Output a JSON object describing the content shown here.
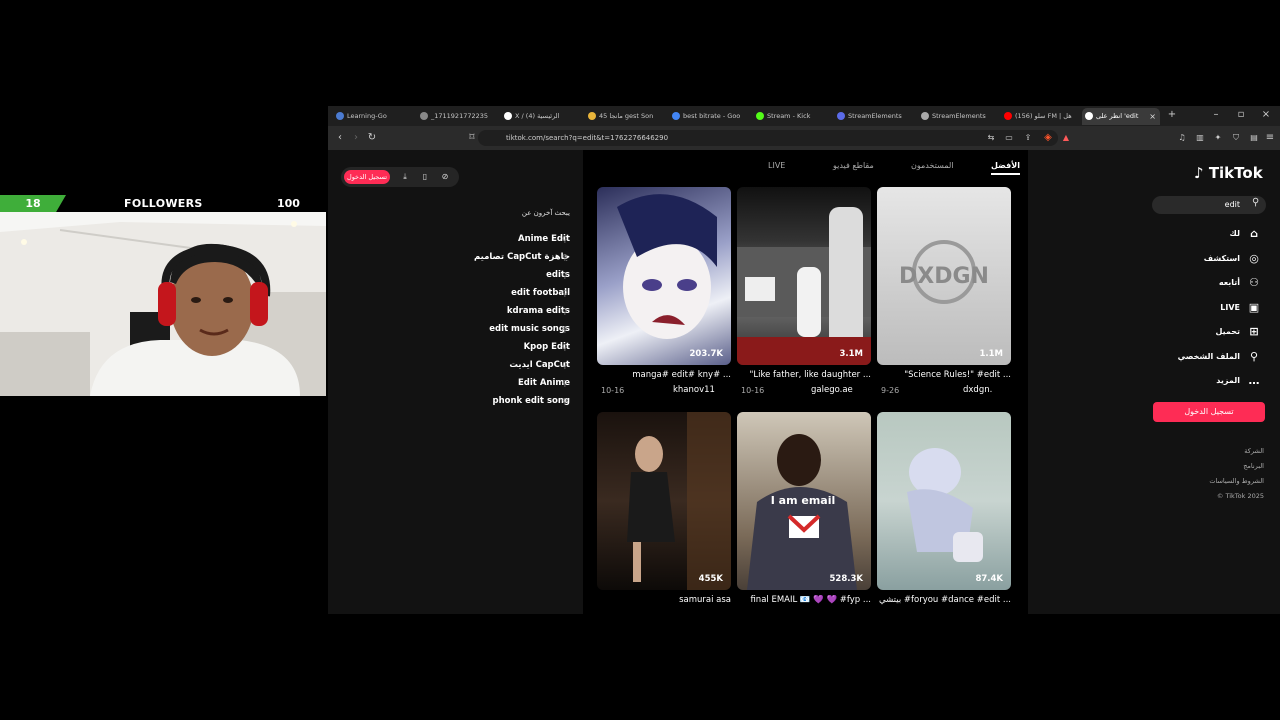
{
  "overlay": {
    "followers_count": "18",
    "followers_label": "FOLLOWERS",
    "followers_goal": "100"
  },
  "browser": {
    "tabs": [
      {
        "label": "Learning-Go"
      },
      {
        "label": "_1711921772235"
      },
      {
        "label": "X / الرئيسية (4)"
      },
      {
        "label": "مانجا 45 gest Son"
      },
      {
        "label": "best bitrate - Goo"
      },
      {
        "label": "Stream - Kick"
      },
      {
        "label": "StreamElements"
      },
      {
        "label": "StreamElements"
      },
      {
        "label": "(156) سلو FM | هل"
      },
      {
        "label": "انظر على 'edit"
      }
    ],
    "url": "tiktok.com/search?q=edit&t=1762276646290"
  },
  "tiktok": {
    "login_small": "تسجيل الدخول",
    "logo": "TikTok",
    "search_value": "edit",
    "nav": [
      {
        "label": "لك",
        "icon": "home-icon",
        "glyph": "⌂"
      },
      {
        "label": "استكشف",
        "icon": "compass-icon",
        "glyph": "◎"
      },
      {
        "label": "أتابعه",
        "icon": "following-icon",
        "glyph": "⚇"
      },
      {
        "label": "LIVE",
        "icon": "live-icon",
        "glyph": "▣"
      },
      {
        "label": "تحميل",
        "icon": "upload-icon",
        "glyph": "⊞"
      },
      {
        "label": "الملف الشخصي",
        "icon": "profile-icon",
        "glyph": "⚲"
      },
      {
        "label": "المزيد",
        "icon": "more-icon",
        "glyph": "…"
      }
    ],
    "login_big": "تسجيل الدخول",
    "footer": [
      "الشركة",
      "البرنامج",
      "الشروط والسياسات",
      "© TikTok 2025"
    ],
    "tabs": [
      "الأفضل",
      "المستخدمون",
      "مقاطع فيديو",
      "LIVE"
    ],
    "people_title": "يبحث آخرون عن",
    "suggestions": [
      "Anime Edit",
      "تصاميم CapCut جاهزة",
      "edits",
      "edit football",
      "kdrama edits",
      "edit music songs",
      "Kpop Edit",
      "ايديت CapCut",
      "Edit Anime",
      "phonk edit song"
    ],
    "videos": [
      {
        "likes": "203.7K",
        "caption": "manga# edit# kny# ...",
        "user": "khanov11",
        "date": "10-16"
      },
      {
        "likes": "3.1M",
        "caption": "\"Like father, like daughter ...",
        "user": "galego.ae",
        "date": "10-16"
      },
      {
        "likes": "1.1M",
        "caption": "\"Science Rules!\" #edit ...",
        "user": "dxdgn.",
        "date": "9-26"
      },
      {
        "likes": "455K",
        "caption": "samurai asa",
        "user": "",
        "date": ""
      },
      {
        "likes": "528.3K",
        "caption": "final EMAIL 📧 💜 💜 #fyp ...",
        "user": "",
        "date": ""
      },
      {
        "likes": "87.4K",
        "caption": "بيتشي #foryou #dance #edit ...",
        "user": "",
        "date": ""
      }
    ],
    "overlay_text": {
      "v3": "DXDGN",
      "v5": "I am email"
    }
  },
  "colors": {
    "accent": "#fe2c55",
    "follower_green": "#3fae3a"
  }
}
